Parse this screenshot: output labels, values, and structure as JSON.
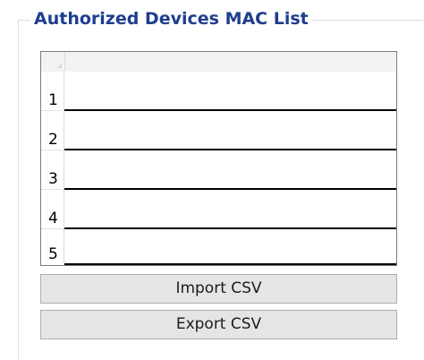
{
  "group": {
    "title": "Authorized Devices MAC List"
  },
  "grid": {
    "rows": [
      {
        "number": "1",
        "value": ""
      },
      {
        "number": "2",
        "value": ""
      },
      {
        "number": "3",
        "value": ""
      },
      {
        "number": "4",
        "value": ""
      },
      {
        "number": "5",
        "value": ""
      }
    ]
  },
  "buttons": {
    "import_label": "Import CSV",
    "export_label": "Export CSV"
  }
}
